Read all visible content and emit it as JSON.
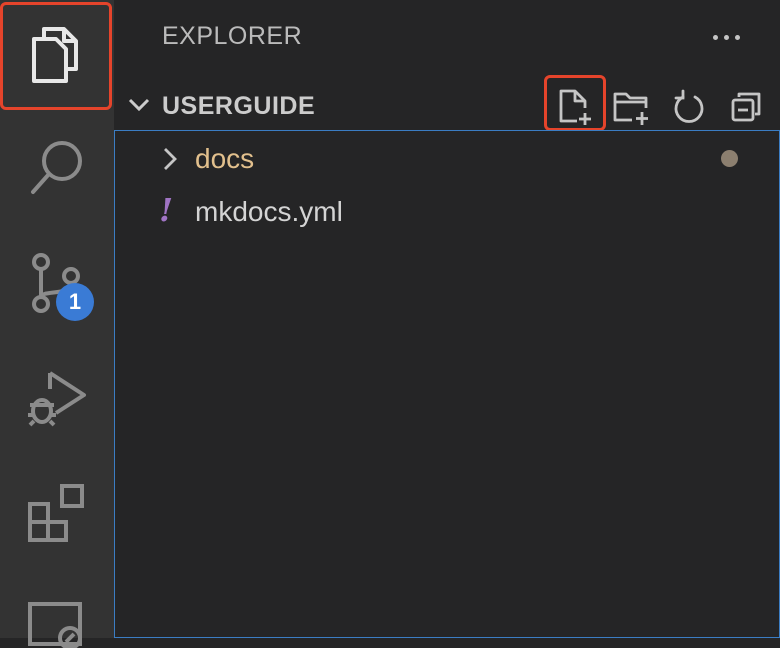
{
  "activity_bar": {
    "items": [
      {
        "name": "explorer",
        "icon": "files-icon"
      },
      {
        "name": "search",
        "icon": "search-icon"
      },
      {
        "name": "source-control",
        "icon": "source-control-icon",
        "badge": "1"
      },
      {
        "name": "run-and-debug",
        "icon": "run-debug-icon"
      },
      {
        "name": "extensions",
        "icon": "extensions-icon"
      },
      {
        "name": "remote-explorer",
        "icon": "remote-explorer-icon"
      }
    ],
    "highlight_color": "#e5442b",
    "badge_color": "#3a7bd5"
  },
  "sidebar": {
    "title": "EXPLORER",
    "more_icon": "ellipsis-icon",
    "section": {
      "title": "USERGUIDE",
      "toolbar": [
        "new-file-icon",
        "new-folder-icon",
        "refresh-icon",
        "collapse-all-icon"
      ]
    },
    "tree": [
      {
        "label": "docs",
        "type": "folder",
        "modified": true,
        "color": "#e2c08d"
      },
      {
        "label": "mkdocs.yml",
        "type": "file",
        "icon_glyph": "!",
        "icon_color": "#a074c4"
      }
    ]
  }
}
